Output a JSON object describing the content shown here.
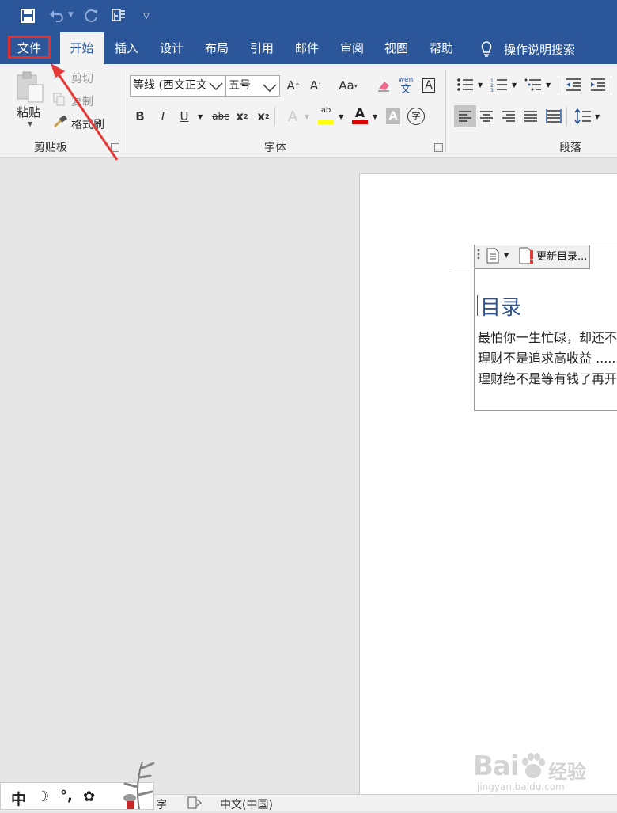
{
  "quick_access": {
    "icons": [
      "save-icon",
      "undo-icon",
      "redo-icon",
      "touch-mode-icon",
      "customize-icon"
    ]
  },
  "tabs": [
    "文件",
    "开始",
    "插入",
    "设计",
    "布局",
    "引用",
    "邮件",
    "审阅",
    "视图",
    "帮助"
  ],
  "active_tab": "开始",
  "tell_me": "操作说明搜索",
  "clipboard": {
    "paste": "粘贴",
    "cut": "剪切",
    "copy": "复制",
    "format_painter": "格式刷",
    "group_label": "剪贴板"
  },
  "font": {
    "font_name": "等线 (西文正文",
    "font_size": "五号",
    "group_label": "字体",
    "wen_label": "文",
    "wen_pinyin": "wén"
  },
  "paragraph": {
    "group_label": "段落"
  },
  "document": {
    "update_toc": "更新目录...",
    "toc_title": "目录",
    "entries": [
      "最怕你一生忙碌，却还不",
      "理财不是追求高收益 .......",
      "理财绝不是等有钱了再开"
    ]
  },
  "status_bar": {
    "word_count_suffix": "字",
    "language": "中文(中国)"
  },
  "ime": {
    "mode": "中",
    "half_moon": "☽",
    "punct": "°,",
    "settings": "✿"
  },
  "watermark": {
    "brand": "Bai",
    "brand2": "经验",
    "url": "jingyan.baidu.com"
  },
  "colors": {
    "title_bar": "#2b579a",
    "highlight_box": "#e03131",
    "toc_title": "#2f5496"
  }
}
